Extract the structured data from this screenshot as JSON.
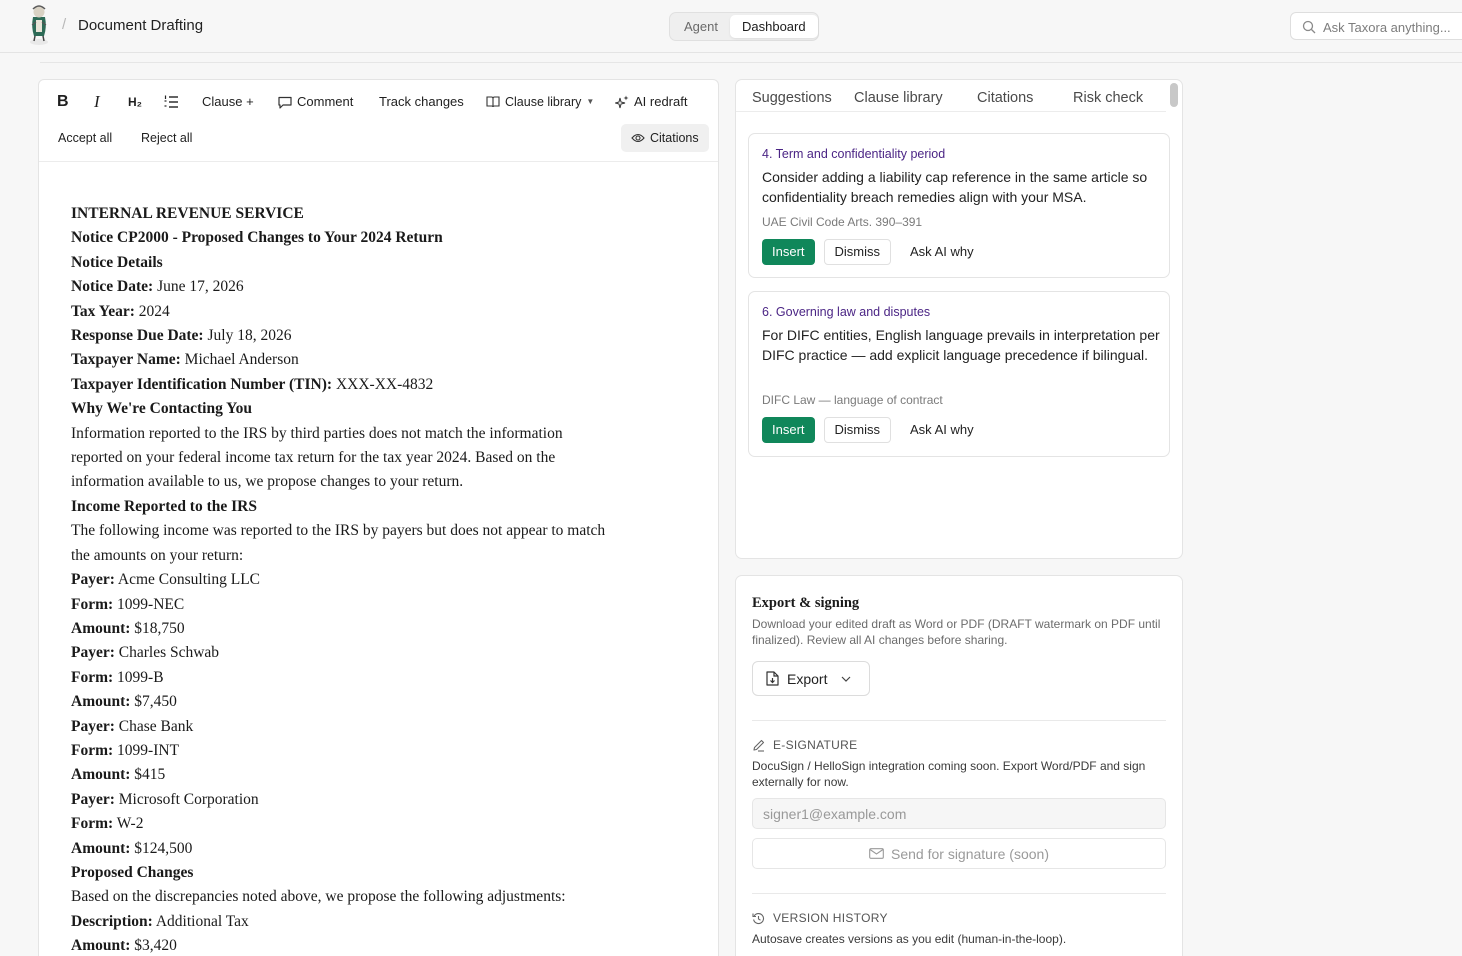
{
  "header": {
    "separator": "/",
    "title": "Document Drafting",
    "segments": [
      "Agent",
      "Dashboard"
    ],
    "active_segment": "Dashboard",
    "search_placeholder": "Ask Taxora anything..."
  },
  "toolbar": {
    "bold": "B",
    "italic": "I",
    "heading": "H₂",
    "clause_add": "Clause +",
    "comment": "Comment",
    "track_changes": "Track changes",
    "clause_library": "Clause library",
    "ai_redraft": "AI redraft",
    "accept_all": "Accept all",
    "reject_all": "Reject all",
    "citations": "Citations"
  },
  "document": {
    "lines": [
      {
        "label": "INTERNAL REVENUE SERVICE",
        "value": "",
        "style": "head"
      },
      {
        "label": "Notice CP2000 - Proposed Changes to Your 2024 Return",
        "value": "",
        "style": "head"
      },
      {
        "label": "Notice Details",
        "value": "",
        "style": "head"
      },
      {
        "label": "Notice Date:",
        "value": "June 17, 2026",
        "style": "kv"
      },
      {
        "label": "Tax Year:",
        "value": "2024",
        "style": "kv"
      },
      {
        "label": "Response Due Date:",
        "value": "July 18, 2026",
        "style": "kv"
      },
      {
        "label": "Taxpayer Name:",
        "value": "Michael Anderson",
        "style": "kv"
      },
      {
        "label": "Taxpayer Identification Number (TIN):",
        "value": "XXX-XX-4832",
        "style": "kv"
      },
      {
        "label": "Why We're Contacting You",
        "value": "",
        "style": "head"
      },
      {
        "label": "",
        "value": "Information reported to the IRS by third parties does not match the information",
        "style": "text"
      },
      {
        "label": "",
        "value": "reported on your federal income tax return for the tax year 2024. Based on the",
        "style": "text"
      },
      {
        "label": "",
        "value": "information available to us, we propose changes to your return.",
        "style": "text"
      },
      {
        "label": "Income Reported to the IRS",
        "value": "",
        "style": "head"
      },
      {
        "label": "",
        "value": "The following income was reported to the IRS by payers but does not appear to match",
        "style": "text"
      },
      {
        "label": "",
        "value": "the amounts on your return:",
        "style": "text"
      },
      {
        "label": "Payer:",
        "value": "Acme Consulting LLC",
        "style": "kv"
      },
      {
        "label": "Form:",
        "value": "1099-NEC",
        "style": "kv"
      },
      {
        "label": "Amount:",
        "value": "$18,750",
        "style": "kv"
      },
      {
        "label": "Payer:",
        "value": "Charles Schwab",
        "style": "kv"
      },
      {
        "label": "Form:",
        "value": "1099-B",
        "style": "kv"
      },
      {
        "label": "Amount:",
        "value": "$7,450",
        "style": "kv"
      },
      {
        "label": "Payer:",
        "value": "Chase Bank",
        "style": "kv"
      },
      {
        "label": "Form:",
        "value": "1099-INT",
        "style": "kv"
      },
      {
        "label": "Amount:",
        "value": "$415",
        "style": "kv"
      },
      {
        "label": "Payer:",
        "value": "Microsoft Corporation",
        "style": "kv"
      },
      {
        "label": "Form:",
        "value": "W-2",
        "style": "kv"
      },
      {
        "label": "Amount:",
        "value": "$124,500",
        "style": "kv"
      },
      {
        "label": "Proposed Changes",
        "value": "",
        "style": "head"
      },
      {
        "label": "",
        "value": "Based on the discrepancies noted above, we propose the following adjustments:",
        "style": "text"
      },
      {
        "label": "Description:",
        "value": "Additional Tax",
        "style": "kv"
      },
      {
        "label": "Amount:",
        "value": "$3,420",
        "style": "kv"
      }
    ]
  },
  "panel": {
    "tabs": [
      "Suggestions",
      "Clause library",
      "Citations",
      "Risk check"
    ],
    "suggestions": [
      {
        "title": "4. Term and confidentiality period",
        "body": "Consider adding a liability cap reference in the same article so confidentiality breach remedies align with your MSA.",
        "source": "UAE Civil Code Arts. 390–391",
        "insert": "Insert",
        "dismiss": "Dismiss",
        "ask": "Ask AI why"
      },
      {
        "title": "6. Governing law and disputes",
        "body": "For DIFC entities, English language prevails in interpretation per DIFC practice — add explicit language precedence if bilingual.",
        "source": "DIFC Law — language of contract",
        "insert": "Insert",
        "dismiss": "Dismiss",
        "ask": "Ask AI why"
      }
    ]
  },
  "export": {
    "title": "Export & signing",
    "desc": "Download your edited draft as Word or PDF (DRAFT watermark on PDF until finalized). Review all AI changes before sharing.",
    "button": "Export",
    "esig_title": "E-SIGNATURE",
    "esig_desc": "DocuSign / HelloSign integration coming soon. Export Word/PDF and sign externally for now.",
    "signer_placeholder": "signer1@example.com",
    "send_button": "Send for signature (soon)",
    "version_title": "VERSION HISTORY",
    "version_desc": "Autosave creates versions as you edit (human-in-the-loop)."
  },
  "colors": {
    "accent_green": "#10875a",
    "clause_purple": "#4b2585"
  }
}
